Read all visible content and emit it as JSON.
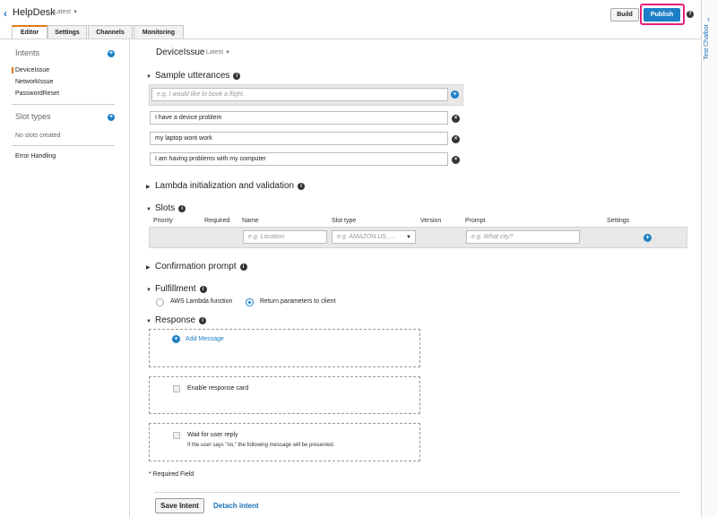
{
  "header": {
    "back_icon": "chevron-left-icon",
    "bot_name": "HelpDesk",
    "bot_version": "Latest",
    "build_label": "Build",
    "publish_label": "Publish",
    "help_icon": "question-icon",
    "accent_color": "#1d7fc7",
    "highlight_color": "#e8207a"
  },
  "tabs": [
    {
      "label": "Editor",
      "active": true
    },
    {
      "label": "Settings",
      "active": false
    },
    {
      "label": "Channels",
      "active": false
    },
    {
      "label": "Monitoring",
      "active": false
    }
  ],
  "sidebar": {
    "intents_heading": "Intents",
    "intents": [
      "DeviceIssue",
      "NetworkIssue",
      "PasswordReset"
    ],
    "slot_types_heading": "Slot types",
    "no_slots": "No slots created",
    "error_handling": "Error Handling"
  },
  "right_panel": {
    "label": "Test Chatbot"
  },
  "intent": {
    "name": "DeviceIssue",
    "version": "Latest"
  },
  "sample_utterances": {
    "heading": "Sample utterances",
    "placeholder": "e.g. I would like to book a flight.",
    "items": [
      "I have a device problem",
      "my laptop wont work",
      "I am having problems with my computer"
    ]
  },
  "lambda_init": {
    "heading": "Lambda initialization and validation"
  },
  "slots": {
    "heading": "Slots",
    "columns": [
      "Priority",
      "Required",
      "Name",
      "Slot type",
      "Version",
      "Prompt",
      "Settings"
    ],
    "name_placeholder": "e.g. Location",
    "type_placeholder": "e.g. AMAZON.US_...",
    "prompt_placeholder": "e.g. What city?"
  },
  "confirmation": {
    "heading": "Confirmation prompt"
  },
  "fulfillment": {
    "heading": "Fulfillment",
    "option_lambda": "AWS Lambda function",
    "option_return": "Return parameters to client",
    "selected": "Return parameters to client"
  },
  "response": {
    "heading": "Response",
    "add_message": "Add Message",
    "enable_card": "Enable response card",
    "wait_reply": "Wait for user reply",
    "wait_note": "If the user says \"no,\" the following message will be presented."
  },
  "footer": {
    "required_note": "* Required Field",
    "save_label": "Save Intent",
    "detach_label": "Detach intent"
  }
}
